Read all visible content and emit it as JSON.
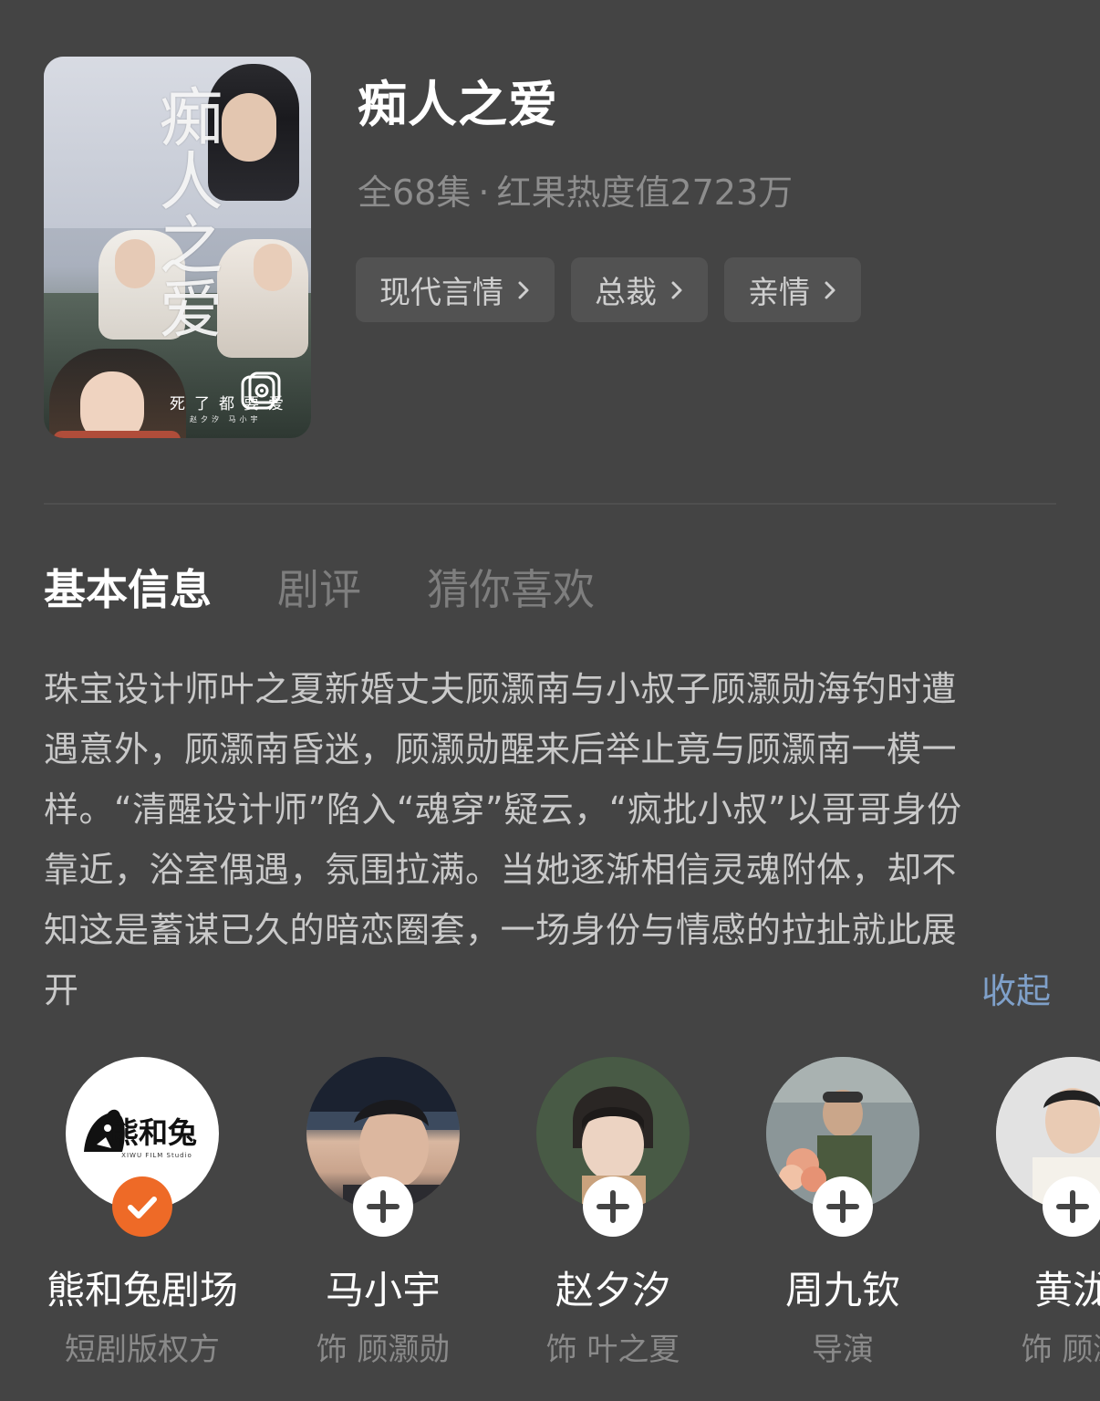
{
  "poster": {
    "calligraphy": "痴人之爱",
    "tagline": "死了都要爱",
    "credits": "赵夕汐 马小宇",
    "badge_icon": "camera-lens-icon"
  },
  "title": "痴人之爱",
  "meta": {
    "episodes": "全68集",
    "separator": "·",
    "heat": "红果热度值2723万"
  },
  "tags": [
    {
      "label": "现代言情"
    },
    {
      "label": "总裁"
    },
    {
      "label": "亲情"
    }
  ],
  "tabs": [
    {
      "label": "基本信息",
      "active": true
    },
    {
      "label": "剧评",
      "active": false
    },
    {
      "label": "猜你喜欢",
      "active": false
    }
  ],
  "synopsis": {
    "lines": [
      "珠宝设计师叶之夏新婚丈夫顾灏南与小叔子顾灏勋海钓时遭",
      "遇意外，顾灏南昏迷，顾灏勋醒来后举止竟与顾灏南一模一",
      "样。“清醒设计师”陷入“魂穿”疑云，“疯批小叔”以哥哥身份",
      "靠近，浴室偶遇，氛围拉满。当她逐渐相信灵魂附体，却不",
      "知这是蓄谋已久的暗恋圈套，一场身份与情感的拉扯就此展",
      "开"
    ],
    "collapse_label": "收起"
  },
  "cast": [
    {
      "name": "熊和兔剧场",
      "role": "短剧版权方",
      "avatar_text": "熊和兔",
      "avatar_subtext": "XIWU FILM Studio",
      "followed": true
    },
    {
      "name": "马小宇",
      "role": "饰 顾灏勋",
      "followed": false
    },
    {
      "name": "赵夕汐",
      "role": "饰 叶之夏",
      "followed": false
    },
    {
      "name": "周九钦",
      "role": "导演",
      "followed": false
    },
    {
      "name": "黄泷",
      "role": "饰 顾灏",
      "followed": false
    }
  ],
  "colors": {
    "background": "#444444",
    "accent_orange": "#ee6a27",
    "link_blue": "#7fa0c9"
  }
}
